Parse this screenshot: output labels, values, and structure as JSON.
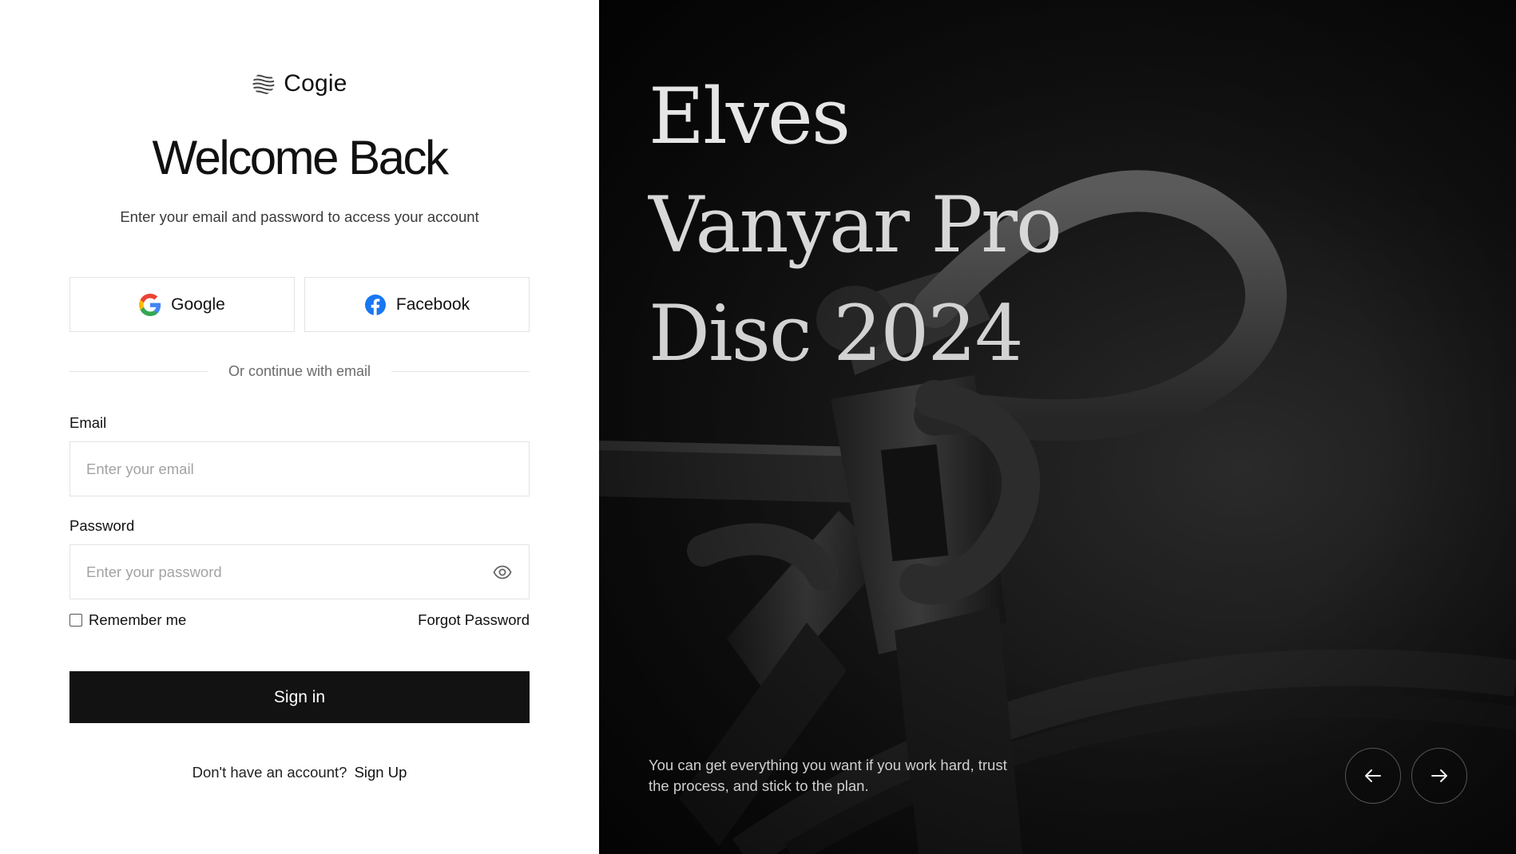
{
  "brand": {
    "name": "Cogie"
  },
  "login": {
    "title": "Welcome Back",
    "subtitle": "Enter your email and password to access your account",
    "google_label": "Google",
    "facebook_label": "Facebook",
    "divider_text": "Or continue with email",
    "email_label": "Email",
    "email_placeholder": "Enter your email",
    "password_label": "Password",
    "password_placeholder": "Enter your password",
    "remember_label": "Remember me",
    "forgot_label": "Forgot Password",
    "signin_label": "Sign in",
    "signup_prompt": "Don't have an account?",
    "signup_link": "Sign Up"
  },
  "hero": {
    "title_line1": "Elves",
    "title_line2": "Vanyar Pro",
    "title_line3": "Disc 2024",
    "quote": "You can get everything you want if you work hard, trust the process, and stick to the plan."
  },
  "icons": {
    "brand_logo": "wave-sphere-icon",
    "google": "google-icon",
    "facebook": "facebook-icon",
    "eye": "eye-icon",
    "prev": "arrow-left-icon",
    "next": "arrow-right-icon"
  },
  "colors": {
    "primary_button": "#121212",
    "facebook_blue": "#1877F2",
    "border": "#e3e3e3",
    "hero_bg": "#0a0a0a"
  }
}
